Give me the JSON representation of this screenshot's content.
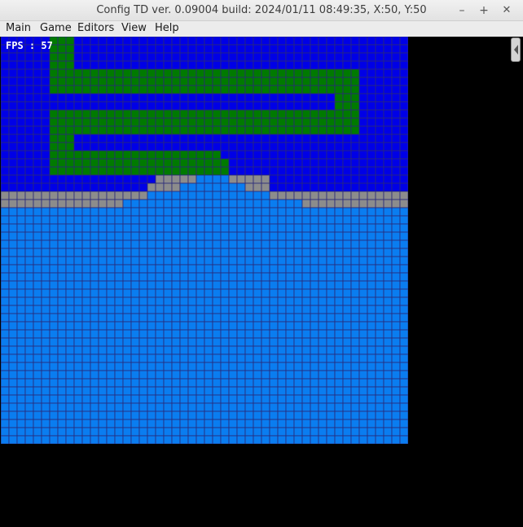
{
  "window": {
    "title": "Config TD ver. 0.09004 build: 2024/01/11  08:49:35, X:50, Y:50",
    "minimize_symbol": "–",
    "maximize_symbol": "+",
    "close_symbol": "✕"
  },
  "menu": {
    "items": [
      {
        "label": "Main"
      },
      {
        "label": "Game"
      },
      {
        "label": "Editors"
      },
      {
        "label": "View"
      },
      {
        "label": "Help"
      }
    ]
  },
  "hud": {
    "fps": "FPS : 57"
  },
  "map": {
    "columns": 50,
    "rows": 50,
    "colors": {
      "water_deep": "#0000e6",
      "path_grass": "#007a00",
      "stone": "#8c8c8c",
      "water_light": "#0a7df0",
      "grid_line": "#2a2a7a"
    }
  }
}
